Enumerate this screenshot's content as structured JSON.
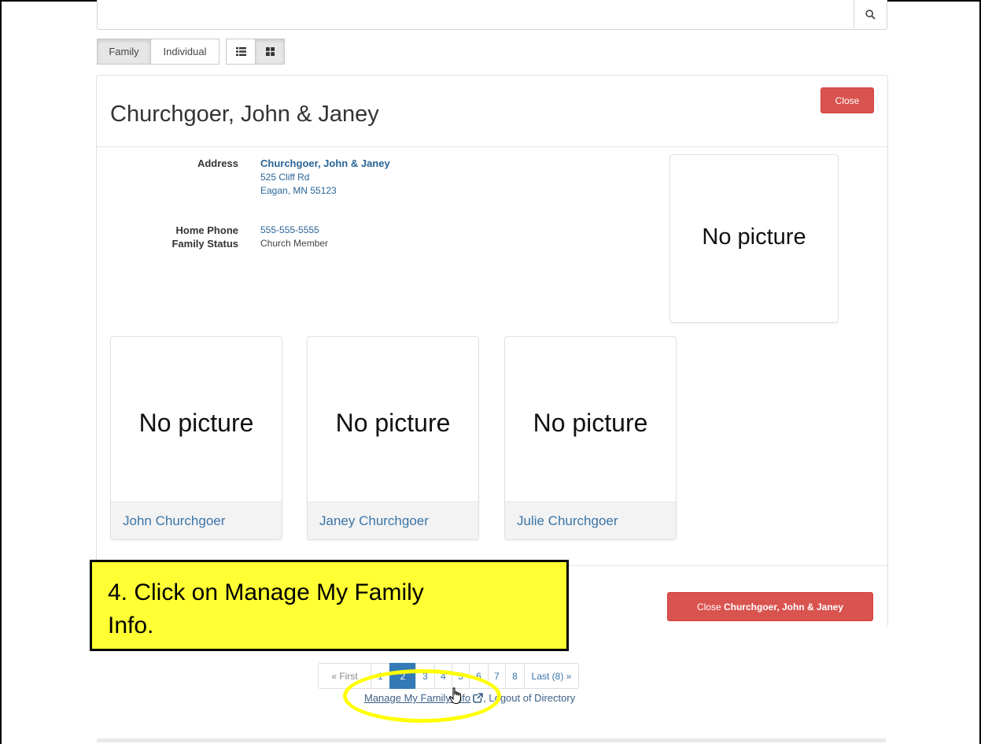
{
  "view_toggle": {
    "family_label": "Family",
    "individual_label": "Individual"
  },
  "family": {
    "title": "Churchgoer, John & Janey",
    "close_label": "Close",
    "address_label": "Address",
    "address_name": "Churchgoer, John & Janey",
    "address_line1": "525 Cliff Rd",
    "address_line2": "Eagan, MN 55123",
    "home_phone_label": "Home Phone",
    "home_phone": "555-555-5555",
    "family_status_label": "Family Status",
    "family_status": "Church Member",
    "family_picture": "No picture",
    "members": [
      {
        "name": "John Churchgoer",
        "picture": "No picture"
      },
      {
        "name": "Janey Churchgoer",
        "picture": "No picture"
      },
      {
        "name": "Julie Churchgoer",
        "picture": "No picture"
      }
    ],
    "footer_close_prefix": "Close",
    "footer_close_name": "Churchgoer, John & Janey"
  },
  "callout": {
    "line1": "4. Click on Manage My Family",
    "line2": "Info."
  },
  "pagination": {
    "first": "« First",
    "pages": [
      "1",
      "2",
      "3",
      "4",
      "5",
      "6",
      "7",
      "8"
    ],
    "active_page": "2",
    "last": "Last (8) »"
  },
  "footer": {
    "manage_label": "Manage My Family Info",
    "separator": ",",
    "logout_label": "Logout of Directory"
  },
  "colors": {
    "danger": "#d9534f",
    "link": "#3a74a8",
    "active_page": "#337ab7",
    "callout_bg": "#ffff33",
    "highlight": "#ffff00"
  }
}
